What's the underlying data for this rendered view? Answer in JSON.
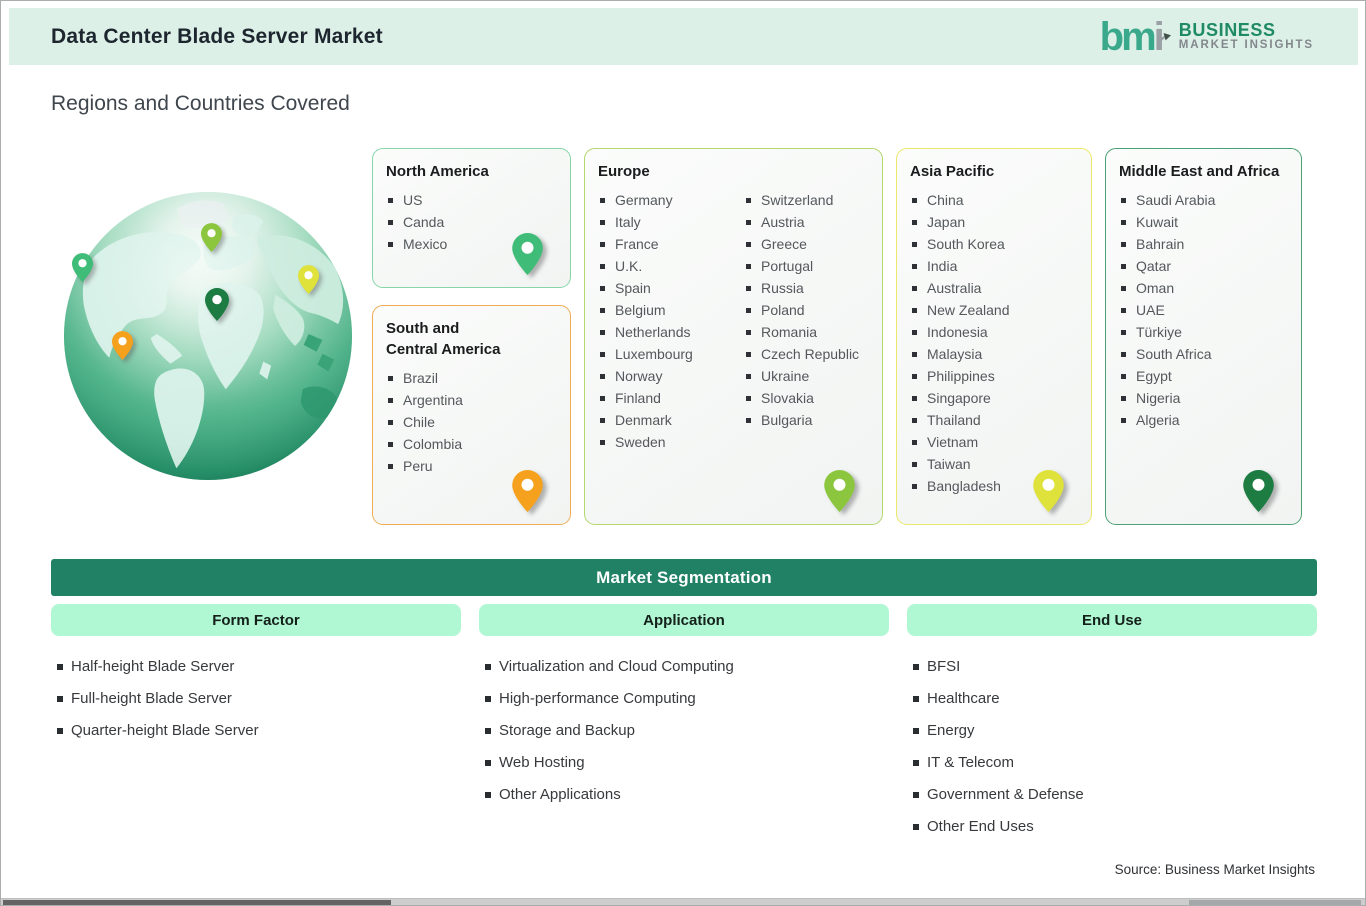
{
  "header": {
    "title": "Data Center Blade Server Market",
    "logo": {
      "mark_bm": "bm",
      "mark_i": "i",
      "line1": "BUSINESS",
      "line2": "MARKET  INSIGHTS"
    }
  },
  "section_title": "Regions and Countries Covered",
  "regions": {
    "north_america": {
      "title": "North America",
      "items": [
        "US",
        "Canda",
        "Mexico"
      ]
    },
    "south_central_america": {
      "title": "South and\nCentral America",
      "items": [
        "Brazil",
        "Argentina",
        "Chile",
        "Colombia",
        "Peru"
      ]
    },
    "europe": {
      "title": "Europe",
      "items_col1": [
        "Germany",
        "Italy",
        "France",
        "U.K.",
        "Spain",
        "Belgium",
        "Netherlands",
        "Luxembourg",
        "Norway",
        "Finland",
        "Denmark",
        "Sweden"
      ],
      "items_col2": [
        "Switzerland",
        "Austria",
        "Greece",
        "Portugal",
        "Russia",
        "Poland",
        "Romania",
        "Czech Republic",
        "Ukraine",
        "Slovakia",
        "Bulgaria"
      ]
    },
    "asia_pacific": {
      "title": "Asia Pacific",
      "items": [
        "China",
        "Japan",
        "South Korea",
        "India",
        "Australia",
        "New Zealand",
        "Indonesia",
        "Malaysia",
        "Philippines",
        "Singapore",
        "Thailand",
        "Vietnam",
        "Taiwan",
        "Bangladesh"
      ]
    },
    "middle_east_africa": {
      "title": "Middle East and Africa",
      "items": [
        "Saudi Arabia",
        "Kuwait",
        "Bahrain",
        "Qatar",
        "Oman",
        "UAE",
        "Türkiye",
        "South Africa",
        "Egypt",
        "Nigeria",
        "Algeria"
      ]
    }
  },
  "segmentation": {
    "title": "Market Segmentation",
    "columns": [
      {
        "label": "Form Factor",
        "items": [
          "Half-height Blade Server",
          "Full-height Blade Server",
          "Quarter-height Blade Server"
        ]
      },
      {
        "label": "Application",
        "items": [
          "Virtualization and Cloud Computing",
          "High-performance Computing",
          "Storage and Backup",
          "Web Hosting",
          "Other Applications"
        ]
      },
      {
        "label": "End Use",
        "items": [
          "BFSI",
          "Healthcare",
          "Energy",
          "IT & Telecom",
          "Government & Defense",
          "Other End Uses"
        ]
      }
    ]
  },
  "source": "Source: Business Market Insights",
  "colors": {
    "header_band": "#ddf0e8",
    "seg_bar_green": "#208165",
    "seg_head_mint": "#b0f7d4",
    "na_border": "#86d6a8",
    "na_pin": "#3fbc77",
    "sca_border": "#f0ad55",
    "sca_pin": "#f5a11e",
    "eu_border": "#b4d76e",
    "eu_pin": "#8cc63e",
    "ap_border": "#ece86a",
    "ap_pin": "#e0e23c",
    "mea_border": "#4ca274",
    "mea_pin": "#1c7c42"
  }
}
